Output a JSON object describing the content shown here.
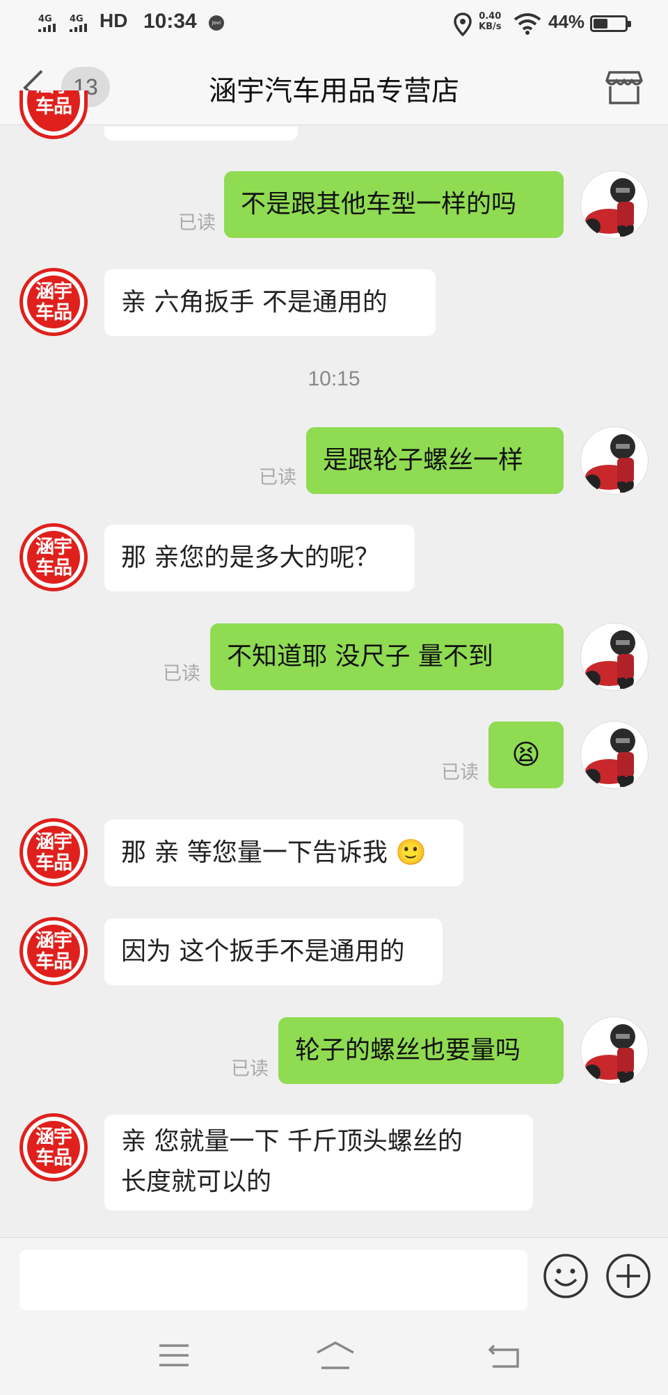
{
  "status_bar": {
    "signal1": "4G",
    "signal2": "4G",
    "hd": "HD",
    "time": "10:34",
    "jovi": "Jovi",
    "speed_value": "0.40",
    "speed_unit": "KB/s",
    "battery": "44%"
  },
  "header": {
    "unread_count": "13",
    "title": "涵宇汽车用品专营店"
  },
  "shop_avatar_text": "涵宇车品",
  "read_label": "已读",
  "messages": [
    {
      "side": "right",
      "text": "不是跟其他车型一样的吗"
    },
    {
      "side": "left",
      "text": "亲  六角扳手 不是通用的"
    },
    {
      "timestamp": "10:15"
    },
    {
      "side": "right",
      "text": "是跟轮子螺丝一样"
    },
    {
      "side": "left",
      "text": "那 亲您的是多大的呢？"
    },
    {
      "side": "right",
      "text": "不知道耶   没尺子   量不到"
    },
    {
      "side": "right",
      "text": "😫"
    },
    {
      "side": "left",
      "text": "那 亲 等您量一下告诉我 🙂"
    },
    {
      "side": "left",
      "text": "因为 这个扳手不是通用的"
    },
    {
      "side": "right",
      "text": "轮子的螺丝也要量吗"
    },
    {
      "side": "left",
      "text_line1": "亲  您就量一下 千斤顶头螺丝的",
      "text_line2": "长度就可以的"
    }
  ],
  "colors": {
    "outgoing_bubble": "#8fdb52",
    "incoming_bubble": "#ffffff",
    "background": "#efefef",
    "shop_red": "#e0201c"
  },
  "icons": {
    "back": "chevron-left-icon",
    "shop": "storefront-icon",
    "emoji": "smiley-icon",
    "plus": "plus-circle-icon",
    "menu": "menu-icon",
    "home": "home-icon",
    "return": "back-icon"
  }
}
